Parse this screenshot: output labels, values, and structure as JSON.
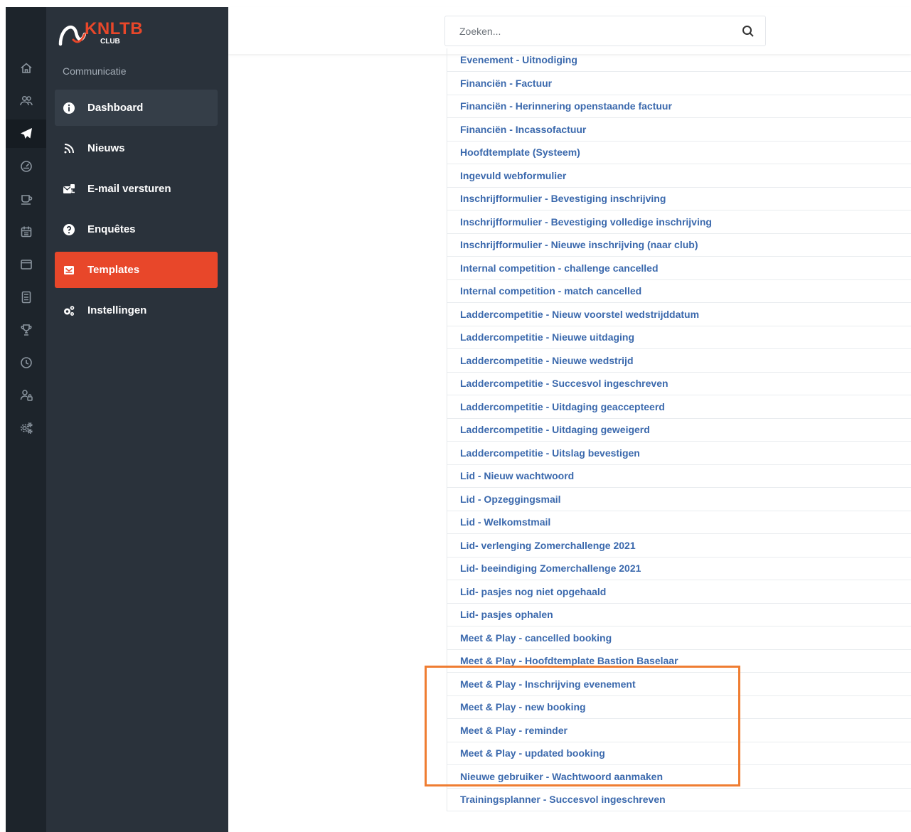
{
  "rail": {
    "icons": [
      {
        "name": "home-icon"
      },
      {
        "name": "users-icon"
      },
      {
        "name": "paper-plane-icon"
      },
      {
        "name": "gauge-icon"
      },
      {
        "name": "cup-icon"
      },
      {
        "name": "calendar-icon"
      },
      {
        "name": "window-icon"
      },
      {
        "name": "calculator-icon"
      },
      {
        "name": "trophy-icon"
      },
      {
        "name": "clock-icon"
      },
      {
        "name": "user-lock-icon"
      },
      {
        "name": "cogs-icon"
      }
    ]
  },
  "brand": {
    "name": "KNLTB",
    "sub": "CLUB",
    "accent": "#e8472a"
  },
  "sidebar": {
    "section": "Communicatie",
    "items": [
      {
        "label": "Dashboard",
        "icon": "info-icon"
      },
      {
        "label": "Nieuws",
        "icon": "rss-icon"
      },
      {
        "label": "E-mail versturen",
        "icon": "mail-send-icon"
      },
      {
        "label": "Enquêtes",
        "icon": "question-icon"
      },
      {
        "label": "Templates",
        "icon": "envelope-icon"
      },
      {
        "label": "Instellingen",
        "icon": "cogs-icon"
      }
    ]
  },
  "search": {
    "placeholder": "Zoeken..."
  },
  "templates": [
    "Evenement - Uitnodiging",
    "Financiën - Factuur",
    "Financiën - Herinnering openstaande factuur",
    "Financiën - Incassofactuur",
    "Hoofdtemplate (Systeem)",
    "Ingevuld webformulier",
    "Inschrijfformulier - Bevestiging inschrijving",
    "Inschrijfformulier - Bevestiging volledige inschrijving",
    "Inschrijfformulier - Nieuwe inschrijving (naar club)",
    "Internal competition - challenge cancelled",
    "Internal competition - match cancelled",
    "Laddercompetitie - Nieuw voorstel wedstrijddatum",
    "Laddercompetitie - Nieuwe uitdaging",
    "Laddercompetitie - Nieuwe wedstrijd",
    "Laddercompetitie - Succesvol ingeschreven",
    "Laddercompetitie - Uitdaging geaccepteerd",
    "Laddercompetitie - Uitdaging geweigerd",
    "Laddercompetitie - Uitslag bevestigen",
    "Lid - Nieuw wachtwoord",
    "Lid - Opzeggingsmail",
    "Lid - Welkomstmail",
    "Lid- verlenging Zomerchallenge 2021",
    "Lid- beeindiging Zomerchallenge 2021",
    "Lid- pasjes nog niet opgehaald",
    "Lid- pasjes ophalen",
    "Meet & Play - cancelled booking",
    "Meet & Play - Hoofdtemplate Bastion Baselaar",
    "Meet & Play - Inschrijving evenement",
    "Meet & Play - new booking",
    "Meet & Play - reminder",
    "Meet & Play - updated booking",
    "Nieuwe gebruiker - Wachtwoord aanmaken",
    "Trainingsplanner - Succesvol ingeschreven"
  ],
  "colors": {
    "link": "#3b69ad",
    "highlight": "#ef7d32",
    "sidebar": "#2a323b",
    "rail": "#1d242b"
  }
}
